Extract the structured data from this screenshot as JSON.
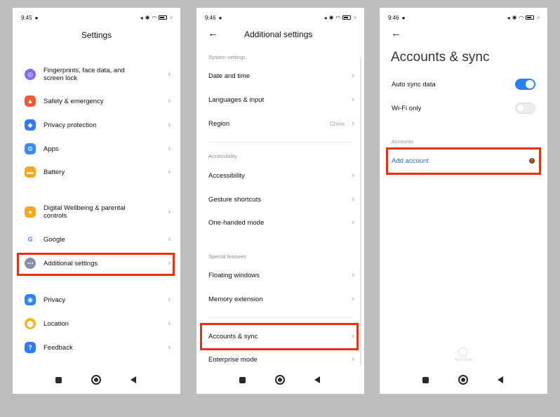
{
  "phone1": {
    "status": {
      "time": "9:45"
    },
    "title": "Settings",
    "items": [
      {
        "label": "Fingerprints, face data, and screen lock",
        "icon": "fingerprint-icon",
        "color": "#7b6cf6"
      },
      {
        "label": "Safety & emergency",
        "icon": "safety-icon",
        "color": "#f05a3c"
      },
      {
        "label": "Privacy protection",
        "icon": "shield-icon",
        "color": "#3478f6"
      },
      {
        "label": "Apps",
        "icon": "apps-icon",
        "color": "#3b8cf2"
      },
      {
        "label": "Battery",
        "icon": "battery-icon",
        "color": "#f5a623"
      },
      {
        "label": "Digital Wellbeing & parental controls",
        "icon": "wellbeing-icon",
        "color": "#f5a623"
      },
      {
        "label": "Google",
        "icon": "google-icon",
        "color": "#ffffff"
      },
      {
        "label": "Additional settings",
        "icon": "more-icon",
        "color": "#8a8fa8"
      },
      {
        "label": "Privacy",
        "icon": "eye-icon",
        "color": "#2d86f0"
      },
      {
        "label": "Location",
        "icon": "location-icon",
        "color": "#f5b323"
      },
      {
        "label": "Feedback",
        "icon": "feedback-icon",
        "color": "#3478f6"
      }
    ]
  },
  "phone2": {
    "status": {
      "time": "9:46"
    },
    "title": "Additional settings",
    "sections": {
      "system": "System settings",
      "accessibility": "Accessibility",
      "special": "Special features"
    },
    "items": {
      "date_time": "Date and time",
      "languages": "Languages & input",
      "region": "Region",
      "region_value": "China",
      "accessibility": "Accessibility",
      "gestures": "Gesture shortcuts",
      "one_handed": "One-handed mode",
      "floating": "Floating windows",
      "memory": "Memory extension",
      "accounts": "Accounts & sync",
      "enterprise": "Enterprise mode"
    }
  },
  "phone3": {
    "status": {
      "time": "9:46"
    },
    "title": "Accounts & sync",
    "auto_sync": {
      "label": "Auto sync data",
      "on": true
    },
    "wifi_only": {
      "label": "Wi-Fi only",
      "on": false
    },
    "section": "Accounts",
    "add_account": "Add account",
    "sync_now": "Sync now"
  },
  "colors": {
    "highlight": "#e43414",
    "accent": "#2a7fef",
    "link": "#1e6fd9"
  }
}
